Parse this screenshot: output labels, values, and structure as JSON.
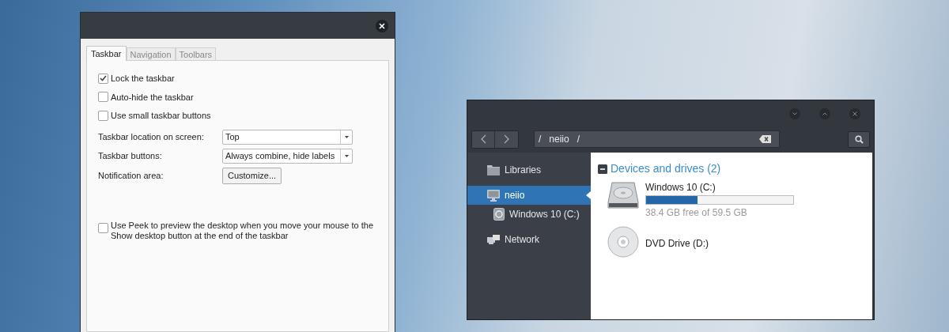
{
  "taskbar_dialog": {
    "tabs": [
      {
        "label": "Taskbar",
        "selected": true
      },
      {
        "label": "Navigation",
        "selected": false
      },
      {
        "label": "Toolbars",
        "selected": false
      }
    ],
    "options": [
      {
        "label": "Lock the taskbar",
        "checked": true
      },
      {
        "label": "Auto-hide the taskbar",
        "checked": false
      },
      {
        "label": "Use small taskbar buttons",
        "checked": false
      }
    ],
    "settings": [
      {
        "label": "Taskbar location on screen:",
        "kind": "dropdown",
        "value": "Top"
      },
      {
        "label": "Taskbar buttons:",
        "kind": "dropdown",
        "value": "Always combine, hide labels"
      },
      {
        "label": "Notification area:",
        "kind": "button",
        "value": "Customize..."
      }
    ],
    "peek_option": {
      "label": "Use Peek to preview the desktop when you move your mouse to the Show desktop button at the end of the taskbar",
      "checked": false
    }
  },
  "explorer": {
    "path": [
      "/",
      "neiio",
      "/"
    ],
    "sidebar": [
      {
        "label": "Libraries",
        "kind": "folder",
        "selected": false
      },
      {
        "label": "neiio",
        "kind": "computer",
        "selected": true,
        "children": [
          {
            "label": "Windows 10 (C:)",
            "kind": "drive",
            "selected": false
          }
        ]
      },
      {
        "label": "Network",
        "kind": "network",
        "selected": false
      }
    ],
    "group_title": "Devices and drives (2)",
    "drives": [
      {
        "name": "Windows 10 (C:)",
        "kind": "hdd",
        "level": 0.35,
        "free_space": "38.4 GB free of 59.5 GB"
      },
      {
        "name": "DVD Drive (D:)",
        "kind": "dvd"
      }
    ]
  }
}
